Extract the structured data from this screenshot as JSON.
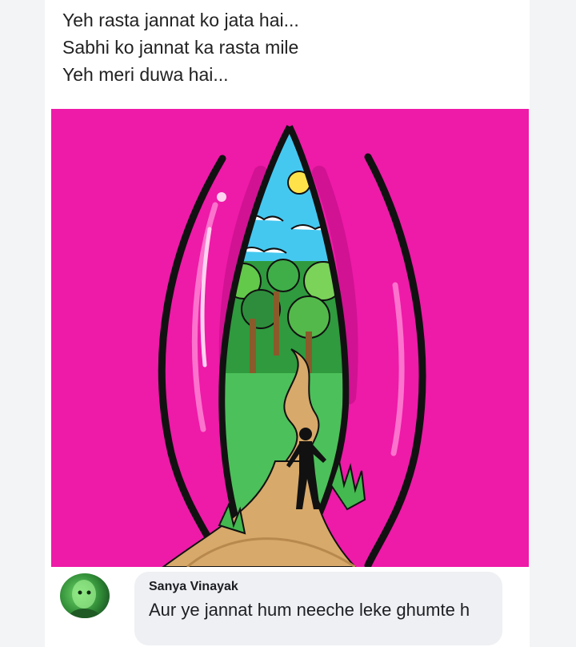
{
  "post": {
    "caption_lines": [
      "Yeh rasta jannat ko jata hai...",
      "Sabhi ko jannat ka rasta mile",
      "Yeh meri duwa hai..."
    ],
    "image_background": "#ee1aa8"
  },
  "comment": {
    "author": "Sanya Vinayak",
    "text": "Aur ye  jannat hum neeche leke ghumte h"
  }
}
